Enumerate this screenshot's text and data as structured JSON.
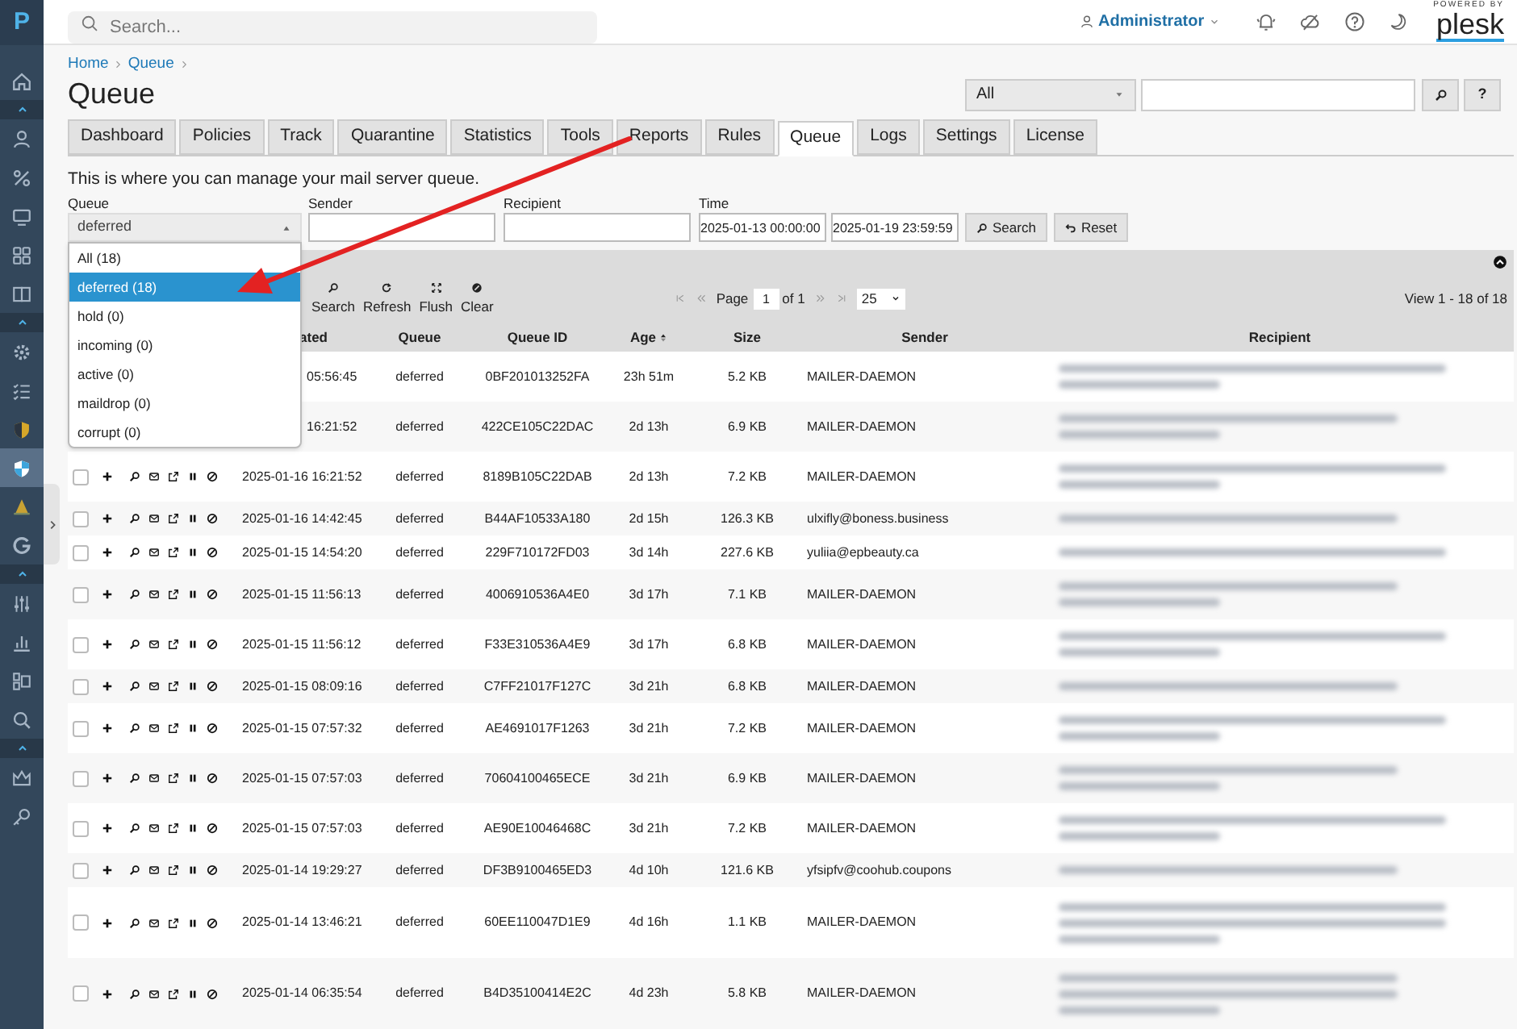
{
  "header": {
    "search_placeholder": "Search...",
    "user": "Administrator",
    "powered_by": "POWERED BY",
    "brand": "plesk"
  },
  "sidebar": {
    "logo": "P",
    "items": [
      {
        "kind": "link",
        "selected": false
      },
      {
        "kind": "toggle",
        "expanded": true
      },
      {
        "kind": "link",
        "selected": false
      },
      {
        "kind": "link",
        "selected": false
      },
      {
        "kind": "link",
        "selected": false
      },
      {
        "kind": "link",
        "selected": false
      },
      {
        "kind": "link",
        "selected": false
      },
      {
        "kind": "toggle",
        "expanded": true
      },
      {
        "kind": "link",
        "selected": false
      },
      {
        "kind": "link",
        "selected": false
      },
      {
        "kind": "link",
        "selected": false
      },
      {
        "kind": "link",
        "selected": true
      },
      {
        "kind": "link",
        "selected": false
      },
      {
        "kind": "link",
        "selected": false
      },
      {
        "kind": "toggle",
        "expanded": true
      },
      {
        "kind": "link",
        "selected": false
      },
      {
        "kind": "link",
        "selected": false
      },
      {
        "kind": "link",
        "selected": false
      },
      {
        "kind": "link",
        "selected": false
      },
      {
        "kind": "toggle",
        "expanded": true
      },
      {
        "kind": "link",
        "selected": false
      },
      {
        "kind": "link",
        "selected": false
      }
    ]
  },
  "breadcrumbs": [
    "Home",
    "Queue"
  ],
  "title": "Queue",
  "quick_search": {
    "scope": "All",
    "help": "?"
  },
  "tabs": [
    {
      "label": "Dashboard",
      "selected": false
    },
    {
      "label": "Policies",
      "selected": false
    },
    {
      "label": "Track",
      "selected": false
    },
    {
      "label": "Quarantine",
      "selected": false
    },
    {
      "label": "Statistics",
      "selected": false
    },
    {
      "label": "Tools",
      "selected": false
    },
    {
      "label": "Reports",
      "selected": false
    },
    {
      "label": "Rules",
      "selected": false
    },
    {
      "label": "Queue",
      "selected": true
    },
    {
      "label": "Logs",
      "selected": false
    },
    {
      "label": "Settings",
      "selected": false
    },
    {
      "label": "License",
      "selected": false
    }
  ],
  "description": "This is where you can manage your mail server queue.",
  "filters": {
    "queue": {
      "label": "Queue",
      "value": "deferred",
      "open": true,
      "options": [
        {
          "label": "All (18)",
          "selected": false
        },
        {
          "label": "deferred (18)",
          "selected": true
        },
        {
          "label": "hold (0)",
          "selected": false
        },
        {
          "label": "incoming (0)",
          "selected": false
        },
        {
          "label": "active (0)",
          "selected": false
        },
        {
          "label": "maildrop (0)",
          "selected": false
        },
        {
          "label": "corrupt (0)",
          "selected": false
        }
      ]
    },
    "sender": {
      "label": "Sender"
    },
    "recipient": {
      "label": "Recipient"
    },
    "time": {
      "label": "Time",
      "from": "2025-01-13 00:00:00",
      "to": "2025-01-19 23:59:59"
    },
    "buttons": [
      {
        "kind": "search",
        "label": "Search"
      },
      {
        "kind": "reset",
        "label": "Reset"
      }
    ]
  },
  "toolbar": [
    {
      "kind": "search",
      "label": "Search"
    },
    {
      "kind": "refresh",
      "label": "Refresh"
    },
    {
      "kind": "flush",
      "label": "Flush"
    },
    {
      "kind": "clear",
      "label": "Clear"
    }
  ],
  "pager": {
    "page_label": "Page",
    "page": "1",
    "of": "of 1",
    "per_page": "25",
    "view": "View 1 - 18 of 18"
  },
  "table": {
    "columns": [
      {
        "label": "ated",
        "sorted": false
      },
      {
        "label": "Queue",
        "sorted": false
      },
      {
        "label": "Queue ID",
        "sorted": false
      },
      {
        "label": "Age",
        "sorted": true
      },
      {
        "label": "Size",
        "sorted": false
      },
      {
        "label": "Sender",
        "sorted": false
      },
      {
        "label": "Recipient",
        "sorted": false
      }
    ],
    "rows": [
      {
        "actions": false,
        "created": "05:56:45",
        "queue": "deferred",
        "queue_id": "0BF201013252FA",
        "age": "23h 51m",
        "size": "5.2 KB",
        "sender": "MAILER-DAEMON"
      },
      {
        "actions": false,
        "created": "16:21:52",
        "queue": "deferred",
        "queue_id": "422CE105C22DAC",
        "age": "2d 13h",
        "size": "6.9 KB",
        "sender": "MAILER-DAEMON"
      },
      {
        "actions": true,
        "checked": false,
        "created": "2025-01-16 16:21:52",
        "queue": "deferred",
        "queue_id": "8189B105C22DAB",
        "age": "2d 13h",
        "size": "7.2 KB",
        "sender": "MAILER-DAEMON"
      },
      {
        "actions": true,
        "checked": false,
        "created": "2025-01-16 14:42:45",
        "queue": "deferred",
        "queue_id": "B44AF10533A180",
        "age": "2d 15h",
        "size": "126.3 KB",
        "sender": "ulxifly@boness.business"
      },
      {
        "actions": true,
        "checked": false,
        "created": "2025-01-15 14:54:20",
        "queue": "deferred",
        "queue_id": "229F710172FD03",
        "age": "3d 14h",
        "size": "227.6 KB",
        "sender": "yuliia@epbeauty.ca"
      },
      {
        "actions": true,
        "checked": false,
        "created": "2025-01-15 11:56:13",
        "queue": "deferred",
        "queue_id": "4006910536A4E0",
        "age": "3d 17h",
        "size": "7.1 KB",
        "sender": "MAILER-DAEMON"
      },
      {
        "actions": true,
        "checked": false,
        "created": "2025-01-15 11:56:12",
        "queue": "deferred",
        "queue_id": "F33E310536A4E9",
        "age": "3d 17h",
        "size": "6.8 KB",
        "sender": "MAILER-DAEMON"
      },
      {
        "actions": true,
        "checked": false,
        "created": "2025-01-15 08:09:16",
        "queue": "deferred",
        "queue_id": "C7FF21017F127C",
        "age": "3d 21h",
        "size": "6.8 KB",
        "sender": "MAILER-DAEMON"
      },
      {
        "actions": true,
        "checked": false,
        "created": "2025-01-15 07:57:32",
        "queue": "deferred",
        "queue_id": "AE4691017F1263",
        "age": "3d 21h",
        "size": "7.2 KB",
        "sender": "MAILER-DAEMON"
      },
      {
        "actions": true,
        "checked": false,
        "created": "2025-01-15 07:57:03",
        "queue": "deferred",
        "queue_id": "70604100465ECE",
        "age": "3d 21h",
        "size": "6.9 KB",
        "sender": "MAILER-DAEMON"
      },
      {
        "actions": true,
        "checked": false,
        "created": "2025-01-15 07:57:03",
        "queue": "deferred",
        "queue_id": "AE90E10046468C",
        "age": "3d 21h",
        "size": "7.2 KB",
        "sender": "MAILER-DAEMON"
      },
      {
        "actions": true,
        "checked": false,
        "created": "2025-01-14 19:29:27",
        "queue": "deferred",
        "queue_id": "DF3B9100465ED3",
        "age": "4d 10h",
        "size": "121.6 KB",
        "sender": "yfsipfv@coohub.coupons"
      },
      {
        "actions": true,
        "checked": false,
        "created": "2025-01-14 13:46:21",
        "queue": "deferred",
        "queue_id": "60EE110047D1E9",
        "age": "4d 16h",
        "size": "1.1 KB",
        "sender": "MAILER-DAEMON"
      },
      {
        "actions": true,
        "checked": false,
        "created": "2025-01-14 06:35:54",
        "queue": "deferred",
        "queue_id": "B4D35100414E2C",
        "age": "4d 23h",
        "size": "5.8 KB",
        "sender": "MAILER-DAEMON"
      }
    ]
  }
}
